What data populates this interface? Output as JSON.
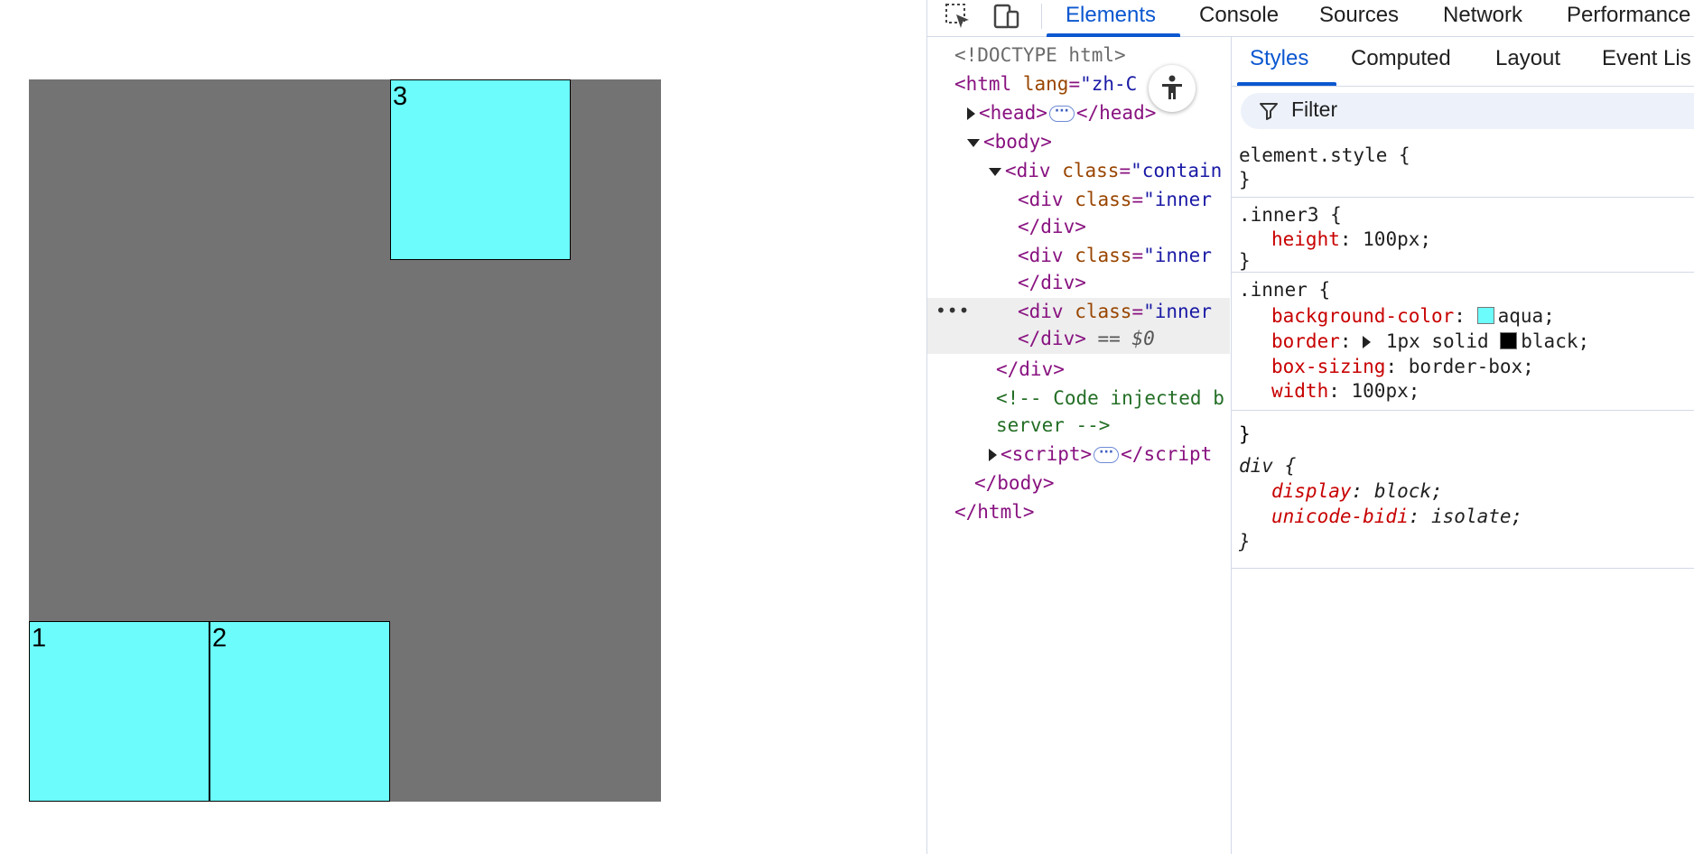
{
  "preview": {
    "boxes": [
      {
        "label": "1"
      },
      {
        "label": "2"
      },
      {
        "label": "3"
      }
    ],
    "colors": {
      "container": "#737373",
      "box": "#6bfcfb",
      "border": "#000000"
    }
  },
  "devtools": {
    "tabs": [
      "Elements",
      "Console",
      "Sources",
      "Network",
      "Performance"
    ],
    "active_tab": "Elements",
    "dom": {
      "doctype": "<!DOCTYPE html>",
      "html_open": "<html",
      "html_attr": "lang",
      "html_val": "\"zh-C",
      "head_open": "<head>",
      "head_close": "</head>",
      "body_open": "<body>",
      "div_open": "<div",
      "div_attr": "class",
      "div_val": "\"contain",
      "inner_open": "<div",
      "inner_attr": "class",
      "inner_val": "\"inner",
      "div_close": "</div>",
      "selected_marker": "== $0",
      "comment_1": "<!-- Code injected b",
      "comment_2": "server -->",
      "script_open": "<script>",
      "script_close": "</script",
      "body_close": "</body>",
      "html_close": "</html>",
      "ellipsis": "•••"
    },
    "styles": {
      "tabs": [
        "Styles",
        "Computed",
        "Layout",
        "Event Lis"
      ],
      "active_tab": "Styles",
      "filter_placeholder": "Filter",
      "rules": {
        "element_style": "element.style {",
        "inner3_selector": ".inner3 {",
        "inner3_height_prop": "height",
        "inner3_height_val": "100px;",
        "inner_selector": ".inner {",
        "bg_prop": "background-color",
        "bg_val": "aqua;",
        "bg_color": "#6bfcfb",
        "border_prop": "border",
        "border_val_a": "1px solid",
        "border_val_b": "black;",
        "border_color": "#000000",
        "boxsizing_prop": "box-sizing",
        "boxsizing_val": "border-box;",
        "width_prop": "width",
        "width_val": "100px;",
        "div_selector": "div {",
        "display_prop": "display",
        "display_val": "block;",
        "bidi_prop": "unicode-bidi",
        "bidi_val": "isolate;",
        "close": "}"
      }
    }
  }
}
